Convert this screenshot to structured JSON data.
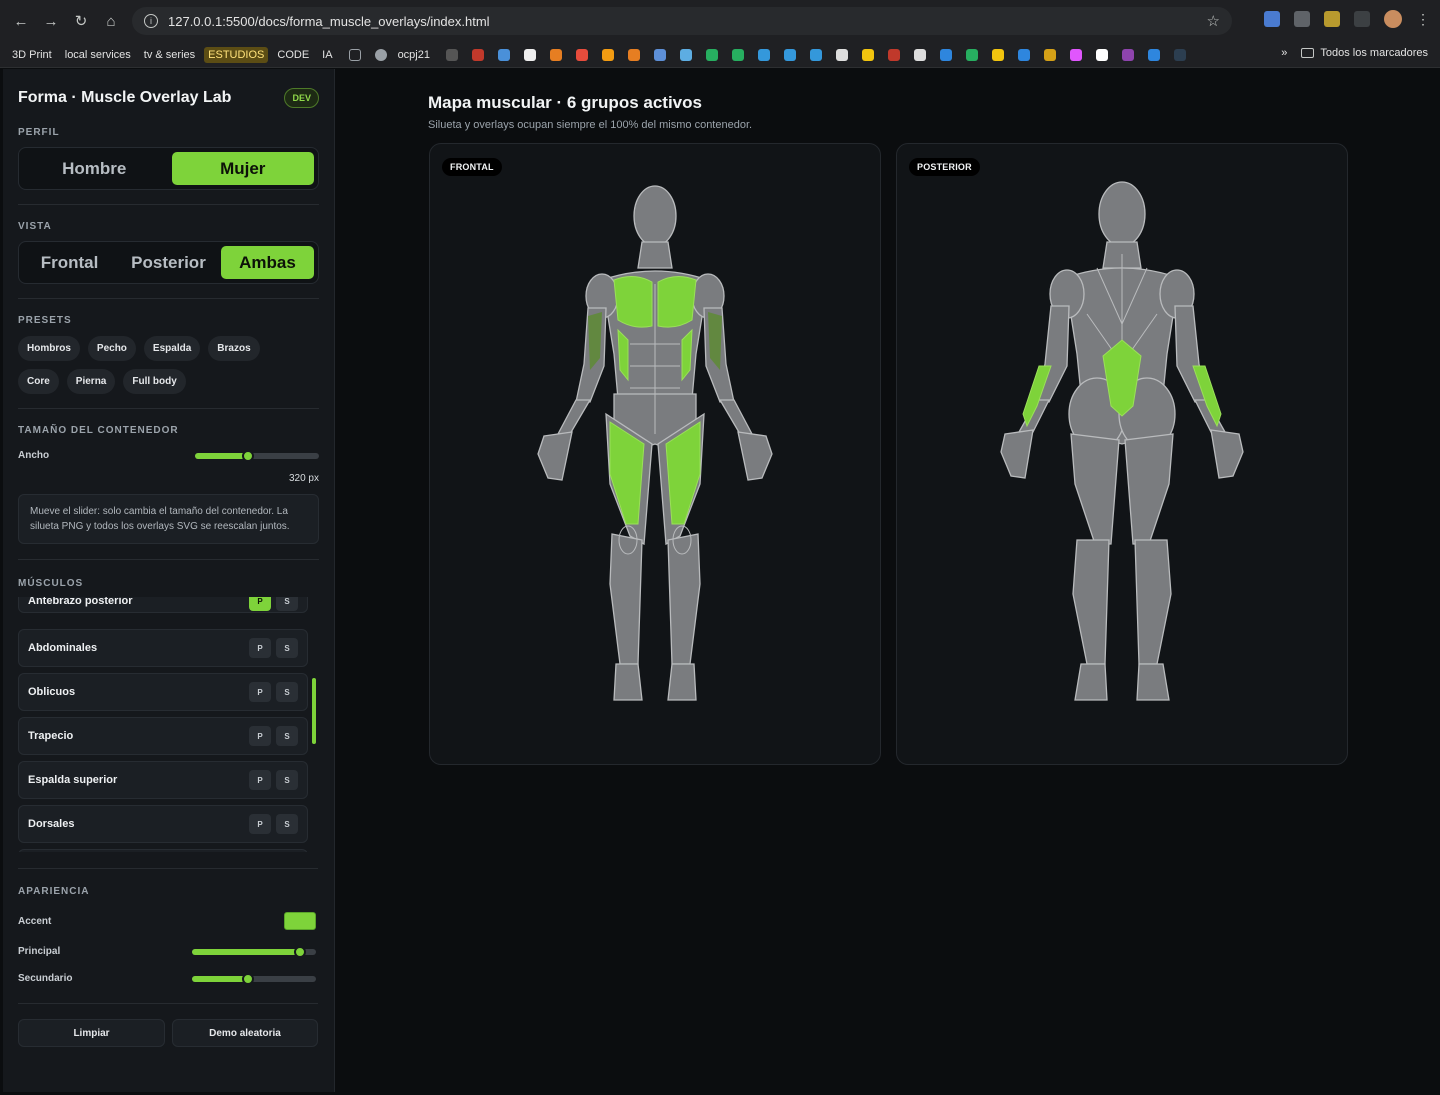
{
  "browser": {
    "url": "127.0.0.1:5500/docs/forma_muscle_overlays/index.html",
    "bookmarks": [
      "3D Print",
      "local services",
      "tv & series",
      "ESTUDIOS",
      "CODE",
      "IA",
      "ocpj21"
    ],
    "all_bookmarks_label": "Todos los marcadores",
    "overflow_label": "»"
  },
  "sidebar": {
    "title": "Forma · Muscle Overlay Lab",
    "badge": "DEV",
    "perfil_label": "PERFIL",
    "perfil_options": [
      "Hombre",
      "Mujer"
    ],
    "perfil_selected": "Mujer",
    "vista_label": "VISTA",
    "vista_options": [
      "Frontal",
      "Posterior",
      "Ambas"
    ],
    "vista_selected": "Ambas",
    "presets_label": "PRESETS",
    "presets": [
      "Hombros",
      "Pecho",
      "Espalda",
      "Brazos",
      "Core",
      "Pierna",
      "Full body"
    ],
    "tamano_label": "TAMAÑO DEL CONTENEDOR",
    "ancho_label": "Ancho",
    "ancho_value": "320 px",
    "ancho_fraction": 0.43,
    "note": "Mueve el slider: solo cambia el tamaño del contenedor. La silueta PNG y todos los overlays SVG se reescalan juntos.",
    "musculos_label": "MÚSCULOS",
    "muscles": [
      {
        "name": "Antebrazo posterior",
        "p": "P",
        "s": "S",
        "p_on": true
      },
      {
        "name": "Abdominales",
        "p": "P",
        "s": "S",
        "p_on": false
      },
      {
        "name": "Oblicuos",
        "p": "P",
        "s": "S",
        "p_on": false
      },
      {
        "name": "Trapecio",
        "p": "P",
        "s": "S",
        "p_on": false
      },
      {
        "name": "Espalda superior",
        "p": "P",
        "s": "S",
        "p_on": false
      },
      {
        "name": "Dorsales",
        "p": "P",
        "s": "S",
        "p_on": false
      }
    ],
    "apariencia_label": "APARIENCIA",
    "accent_label": "Accent",
    "accent_color": "#7ed33a",
    "principal_label": "Principal",
    "principal_fraction": 0.87,
    "secundario_label": "Secundario",
    "secundario_fraction": 0.45,
    "limpiar_label": "Limpiar",
    "demo_label": "Demo aleatoria"
  },
  "main": {
    "title": "Mapa muscular · 6 grupos activos",
    "subtitle": "Silueta y overlays ocupan siempre el 100% del mismo contenedor.",
    "front_tag": "FRONTAL",
    "back_tag": "POSTERIOR",
    "silhouette_color": "#7a7c7f",
    "highlight_color": "#7ed33a"
  }
}
